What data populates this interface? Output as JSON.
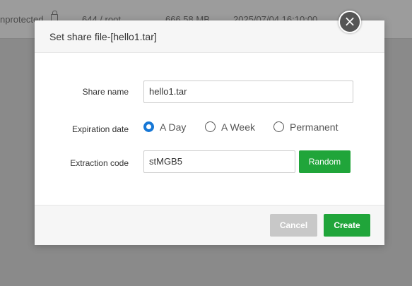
{
  "background": {
    "row_status": "nprotected",
    "row_perm": "644 / root",
    "row_size": "666.58 MB",
    "row_time": "2025/07/04 16:10:00"
  },
  "dialog": {
    "title": "Set share file-[hello1.tar]",
    "close_glyph": "×",
    "share_name": {
      "label": "Share name",
      "value": "hello1.tar"
    },
    "expiration": {
      "label": "Expiration date",
      "options": [
        {
          "label": "A Day",
          "checked": true
        },
        {
          "label": "A Week",
          "checked": false
        },
        {
          "label": "Permanent",
          "checked": false
        }
      ]
    },
    "extraction": {
      "label": "Extraction code",
      "value": "stMGB5",
      "random_label": "Random"
    },
    "footer": {
      "cancel_label": "Cancel",
      "create_label": "Create"
    },
    "colors": {
      "accent": "#20a53a",
      "radio_active": "#1677d6",
      "cancel": "#c8c8c8"
    }
  }
}
